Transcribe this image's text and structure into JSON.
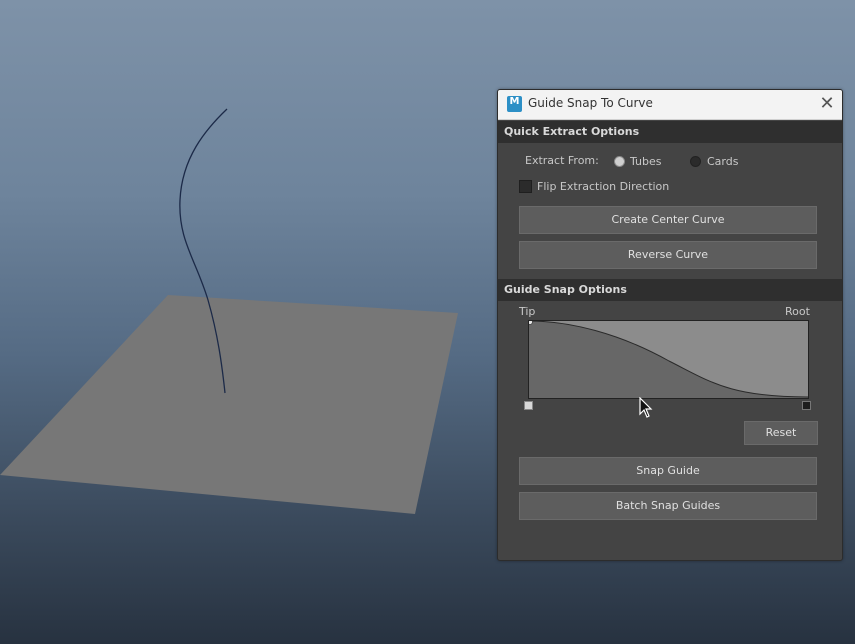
{
  "dialog": {
    "title": "Guide Snap To Curve",
    "app_icon_letter": "M",
    "app_icon_sub": "2025",
    "close_glyph": "✕"
  },
  "quick_extract": {
    "header": "Quick Extract Options",
    "extract_from_label": "Extract From:",
    "options": [
      {
        "label": "Tubes",
        "selected": true
      },
      {
        "label": "Cards",
        "selected": false
      }
    ],
    "flip_label": "Flip Extraction Direction",
    "flip_checked": false,
    "create_center_curve": "Create Center Curve",
    "reverse_curve": "Reverse Curve"
  },
  "guide_snap": {
    "header": "Guide Snap Options",
    "tip_label": "Tip",
    "root_label": "Root",
    "reset": "Reset",
    "snap_guide": "Snap Guide",
    "batch_snap_guides": "Batch Snap Guides"
  },
  "colors": {
    "dialog_bg": "#444444",
    "section_header_bg": "#2f2f2f",
    "button_bg": "#5d5d5d",
    "graph_upper": "#8c8c8c",
    "graph_lower": "#676767",
    "viewport_curve": "#1c2a48",
    "ground_plane": "#767676"
  },
  "icons": [
    "maya-app-icon",
    "close-icon",
    "mouse-cursor-icon"
  ]
}
